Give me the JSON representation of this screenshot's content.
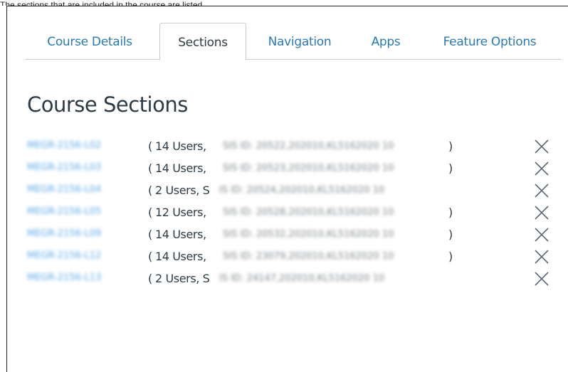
{
  "caption": "The sections that are included in the course are listed",
  "tabs": [
    {
      "label": "Course Details",
      "active": false
    },
    {
      "label": "Sections",
      "active": true
    },
    {
      "label": "Navigation",
      "active": false
    },
    {
      "label": "Apps",
      "active": false
    },
    {
      "label": "Feature Options",
      "active": false
    }
  ],
  "title": "Course Sections",
  "sections": [
    {
      "name": "MEGR-2156-L02",
      "users": "14 Users,",
      "sis": "SIS ID: 20522,202010,KL5162020 10",
      "close": ")"
    },
    {
      "name": "MEGR-2156-L03",
      "users": "14 Users,",
      "sis": "SIS ID: 20523,202010,KL5162020 10",
      "close": ")"
    },
    {
      "name": "MEGR-2156-L04",
      "users": "2 Users, S",
      "sis": "IS ID: 20524,202010,KL5162020 10",
      "close": ""
    },
    {
      "name": "MEGR-2156-L05",
      "users": "12 Users,",
      "sis": "SIS ID: 20528,202010,KL5162020 10",
      "close": ")"
    },
    {
      "name": "MEGR-2156-L09",
      "users": "14 Users,",
      "sis": "SIS ID: 20532,202010,KL5162020 10",
      "close": ")"
    },
    {
      "name": "MEGR-2156-L12",
      "users": "14 Users,",
      "sis": "SIS ID: 23079,202010,KL5162020 10",
      "close": ")"
    },
    {
      "name": "MEGR-2156-L13",
      "users": "2 Users, S",
      "sis": "IS ID: 24147,202010,KL5162020 10",
      "close": ""
    }
  ],
  "colors": {
    "link": "#2a7ab0",
    "text": "#2d3b45",
    "border": "#c7cdd1",
    "remove_icon": "#5b6670"
  },
  "remove_icon": "close-x-icon"
}
